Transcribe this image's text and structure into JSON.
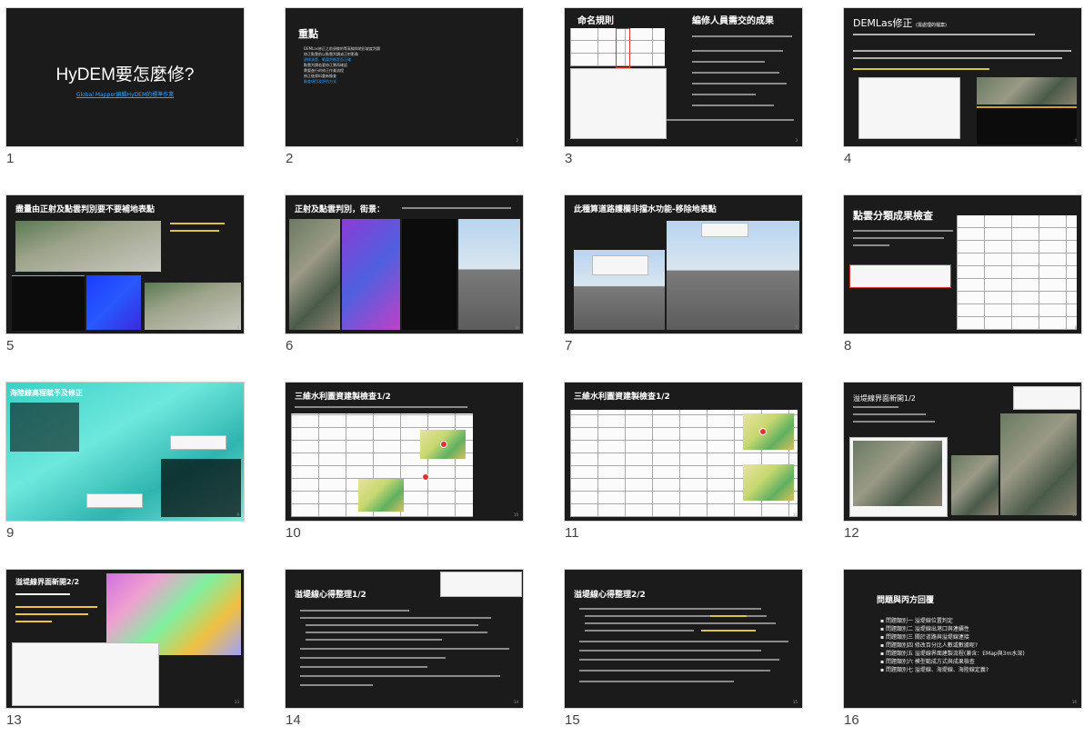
{
  "slides": [
    {
      "num": "1",
      "title": "HyDEM要怎麼修?",
      "subtitle": "Global Mapper編輯HyDEM的標準作業"
    },
    {
      "num": "2",
      "title": "重點",
      "items": [
        "DEMLas修正之前須做的等高線與地形坡度判讀",
        "修正點雲前以點雲判讀或正射影像",
        "邊緣清楚、範圍判斷是否正確",
        "點雲判讀若要修正需再確認",
        "需要進行的修正作業流程",
        "修正後資料重新檢查",
        "檢查項目及評估方式"
      ]
    },
    {
      "num": "3",
      "title": "命名規則",
      "title2": "編修人員需交的成果"
    },
    {
      "num": "4",
      "title": "DEMLas修正",
      "title_note": "(需處理的檔案)"
    },
    {
      "num": "5",
      "title": "盡量由正射及點雲判別要不要補地表點"
    },
    {
      "num": "6",
      "title": "正射及點雲判別，街景："
    },
    {
      "num": "7",
      "title": "此種算道路護欄非擋水功能-移除地表點"
    },
    {
      "num": "8",
      "title": "點雲分類成果檢查"
    },
    {
      "num": "9",
      "title": "海陸線高程賦予及修正"
    },
    {
      "num": "10",
      "title": "三維水利圖資建製檢查1/2"
    },
    {
      "num": "11",
      "title": "三維水利圖資建製檢查1/2"
    },
    {
      "num": "12",
      "title": "溢堤線界面新開1/2"
    },
    {
      "num": "13",
      "title": "溢堤線界面新開2/2"
    },
    {
      "num": "14",
      "title": "溢堤線心得整理1/2"
    },
    {
      "num": "15",
      "title": "溢堤線心得整理2/2"
    },
    {
      "num": "16",
      "title": "問題與丙方回覆",
      "items": [
        "問題類別一 溢堤線位置判定",
        "問題類別二 溢堤線出港口與連續性",
        "問題類別三 關於道路與溢堤線連接",
        "問題類別四 修改百分比人數或數據呢?",
        "問題類別五 溢堤線界面建製流程(兼含：EMap與3m水深)",
        "問題類別六 模型範成方式與成果檢查",
        "問題類別七 溢堤線、海堤線、海陸線定義?"
      ]
    }
  ],
  "colors": {
    "slide_bg": "#1b1b1b",
    "link": "#2ea0ff",
    "highlight": "#f0e040"
  }
}
